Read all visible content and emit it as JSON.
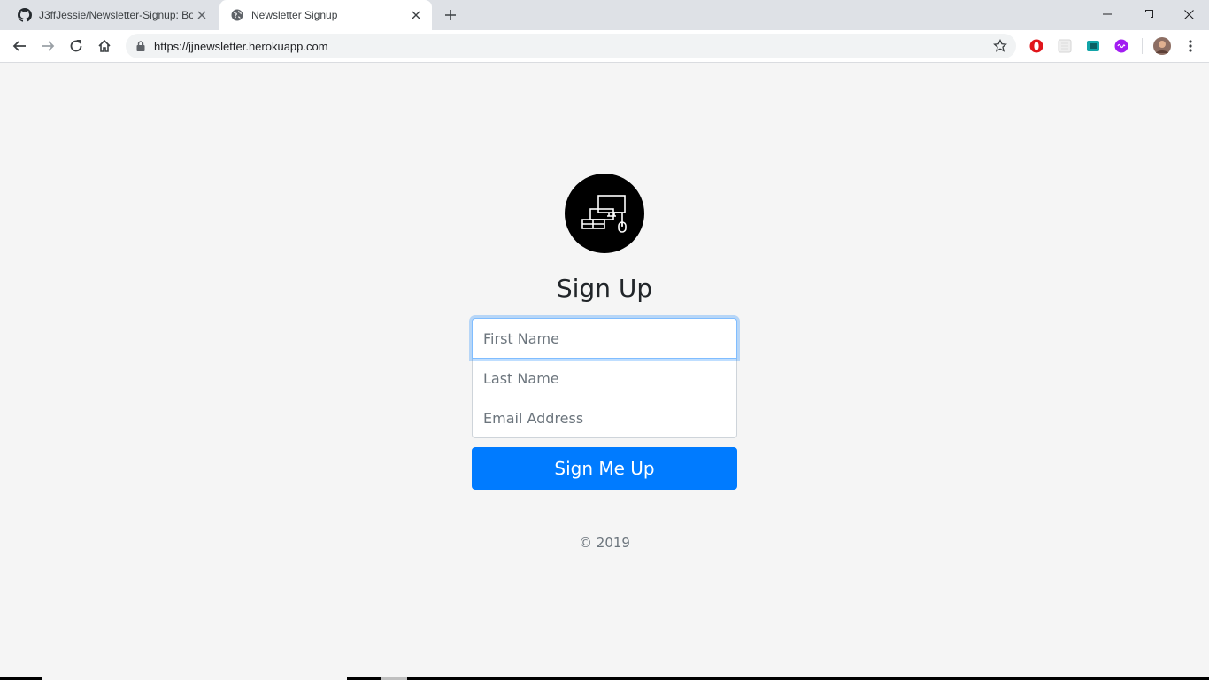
{
  "browser": {
    "tabs": [
      {
        "title": "J3ffJessie/Newsletter-Signup: Bo",
        "favicon": "github-icon",
        "active": false
      },
      {
        "title": "Newsletter Signup",
        "favicon": "globe-icon",
        "active": true
      }
    ],
    "url": "https://jjnewsletter.herokuapp.com",
    "extensions": [
      "opera-icon",
      "blank-extension-icon",
      "teal-extension-icon",
      "purple-extension-icon"
    ]
  },
  "page": {
    "heading": "Sign Up",
    "form": {
      "first_name_placeholder": "First Name",
      "last_name_placeholder": "Last Name",
      "email_placeholder": "Email Address",
      "submit_label": "Sign Me Up"
    },
    "footer": "© 2019"
  },
  "colors": {
    "primary": "#007bff",
    "background": "#f5f5f5",
    "logo": "#000000"
  }
}
